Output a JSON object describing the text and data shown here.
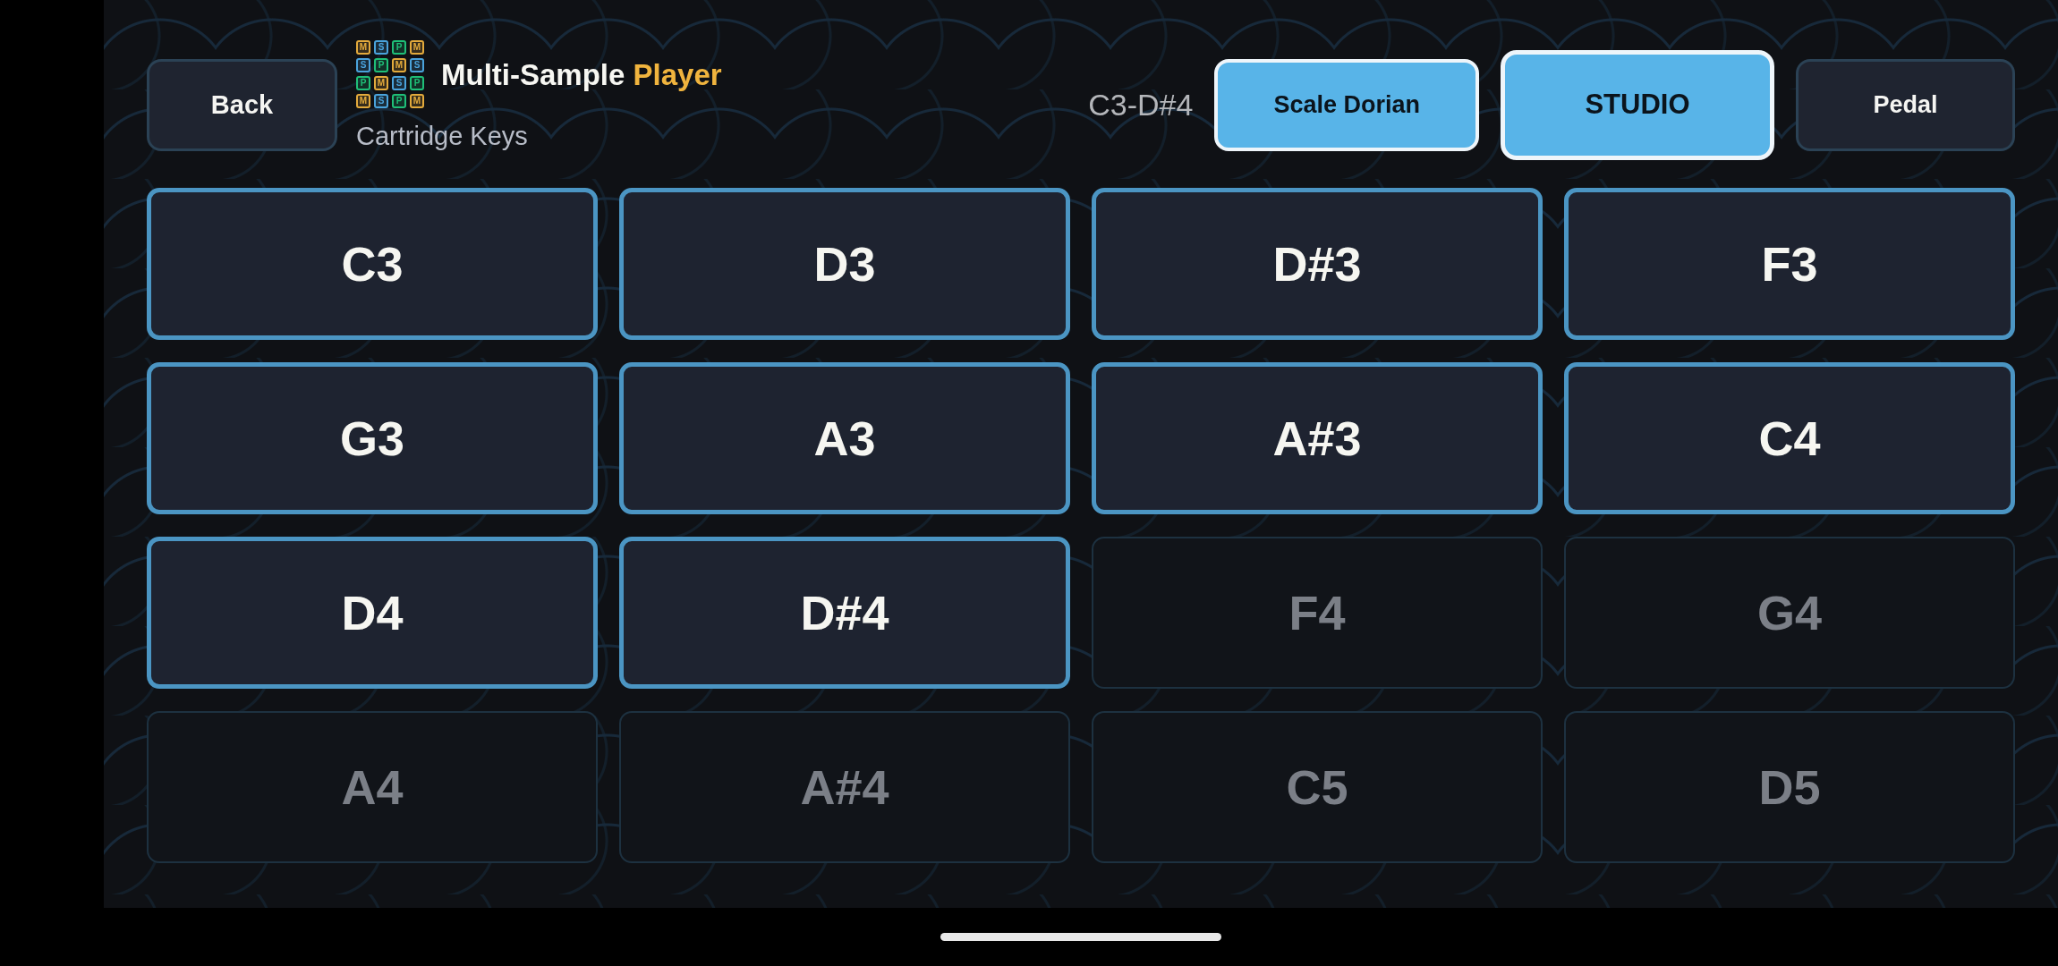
{
  "header": {
    "back_button": "Back",
    "logo": {
      "tiles": [
        {
          "letter": "M",
          "color": "#e3aa3c"
        },
        {
          "letter": "S",
          "color": "#4aa3dc"
        },
        {
          "letter": "P",
          "color": "#1fbf78"
        },
        {
          "letter": "M",
          "color": "#e3aa3c"
        },
        {
          "letter": "S",
          "color": "#4aa3dc"
        },
        {
          "letter": "P",
          "color": "#1fbf78"
        },
        {
          "letter": "M",
          "color": "#e3aa3c"
        },
        {
          "letter": "S",
          "color": "#4aa3dc"
        },
        {
          "letter": "P",
          "color": "#1fbf78"
        },
        {
          "letter": "M",
          "color": "#e3aa3c"
        },
        {
          "letter": "S",
          "color": "#4aa3dc"
        },
        {
          "letter": "P",
          "color": "#1fbf78"
        },
        {
          "letter": "M",
          "color": "#e3aa3c"
        },
        {
          "letter": "S",
          "color": "#4aa3dc"
        },
        {
          "letter": "P",
          "color": "#1fbf78"
        },
        {
          "letter": "M",
          "color": "#e3aa3c"
        }
      ]
    },
    "title": {
      "text": "Multi-Sample",
      "accent": "Player"
    },
    "subtitle": "Cartridge Keys",
    "range": "C3-D#4",
    "toggles": [
      {
        "label": "Scale Dorian",
        "kind": "toggle",
        "on": true
      },
      {
        "label": "STUDIO",
        "kind": "mode",
        "on": true
      },
      {
        "label": "Pedal",
        "kind": "toggle",
        "on": false
      }
    ]
  },
  "pads": [
    {
      "label": "C3",
      "disabled": false
    },
    {
      "label": "D3",
      "disabled": false
    },
    {
      "label": "D#3",
      "disabled": false
    },
    {
      "label": "F3",
      "disabled": false
    },
    {
      "label": "G3",
      "disabled": false
    },
    {
      "label": "A3",
      "disabled": false
    },
    {
      "label": "A#3",
      "disabled": false
    },
    {
      "label": "C4",
      "disabled": false
    },
    {
      "label": "D4",
      "disabled": false
    },
    {
      "label": "D#4",
      "disabled": false
    },
    {
      "label": "F4",
      "disabled": true
    },
    {
      "label": "G4",
      "disabled": true
    },
    {
      "label": "A4",
      "disabled": true
    },
    {
      "label": "A#4",
      "disabled": true
    },
    {
      "label": "C5",
      "disabled": true
    },
    {
      "label": "D5",
      "disabled": true
    }
  ]
}
